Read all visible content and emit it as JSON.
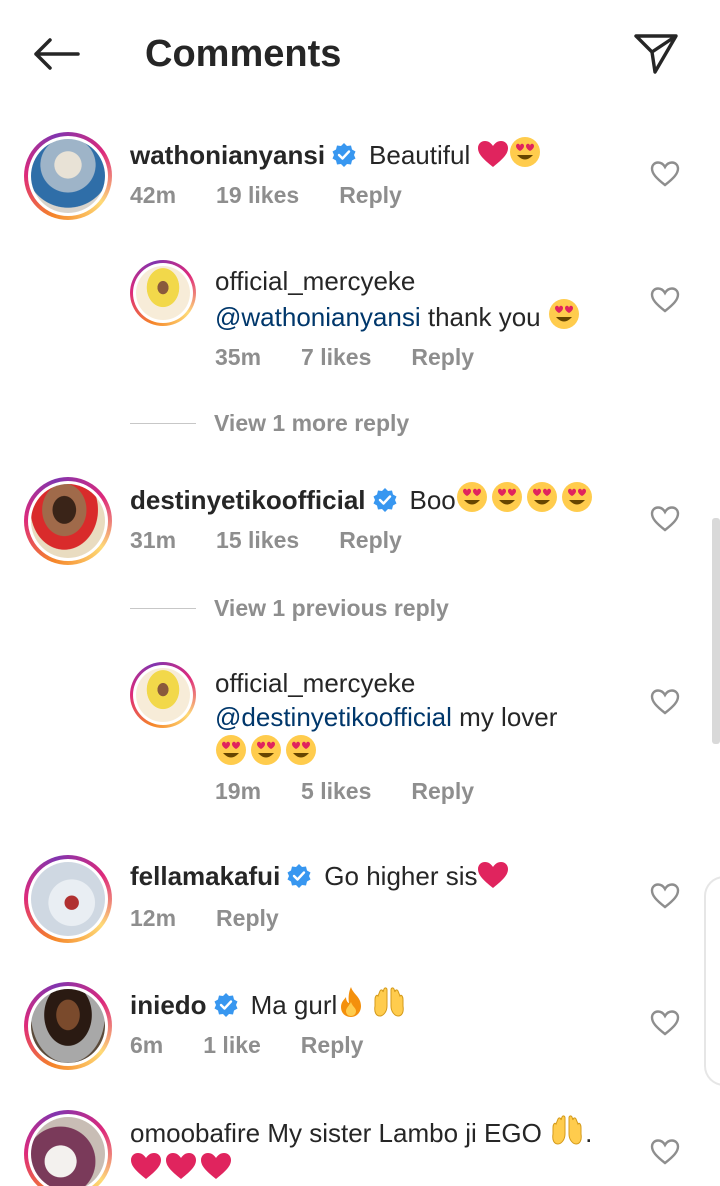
{
  "header": {
    "title": "Comments"
  },
  "comments": [
    {
      "username": "wathonianyansi",
      "verified": true,
      "text": "Beautiful",
      "time": "42m",
      "likes": "19 likes",
      "reply": "Reply"
    },
    {
      "username": "official_mercyeke",
      "verified": false,
      "mention": "@wathonianyansi",
      "text": "thank you",
      "time": "35m",
      "likes": "7 likes",
      "reply": "Reply"
    },
    {
      "view_more": "View 1 more reply"
    },
    {
      "username": "destinyetikoofficial",
      "verified": true,
      "text": "Boo",
      "time": "31m",
      "likes": "15 likes",
      "reply": "Reply"
    },
    {
      "view_more": "View 1 previous reply"
    },
    {
      "username": "official_mercyeke",
      "verified": false,
      "mention": "@destinyetikoofficial",
      "text": "my lover",
      "time": "19m",
      "likes": "5 likes",
      "reply": "Reply"
    },
    {
      "username": "fellamakafui",
      "verified": true,
      "text": "Go higher sis",
      "time": "12m",
      "reply": "Reply"
    },
    {
      "username": "iniedo",
      "verified": true,
      "text": "Ma gurl",
      "time": "6m",
      "likes": "1 like",
      "reply": "Reply"
    },
    {
      "username": "omoobafire",
      "verified": false,
      "text": "My sister Lambo ji EGO",
      "text_end": "."
    }
  ],
  "colors": {
    "verified_blue": "#3897f0",
    "heart_red": "#e0245e",
    "mention_blue": "#00376b",
    "meta_gray": "#8e8e8e"
  }
}
